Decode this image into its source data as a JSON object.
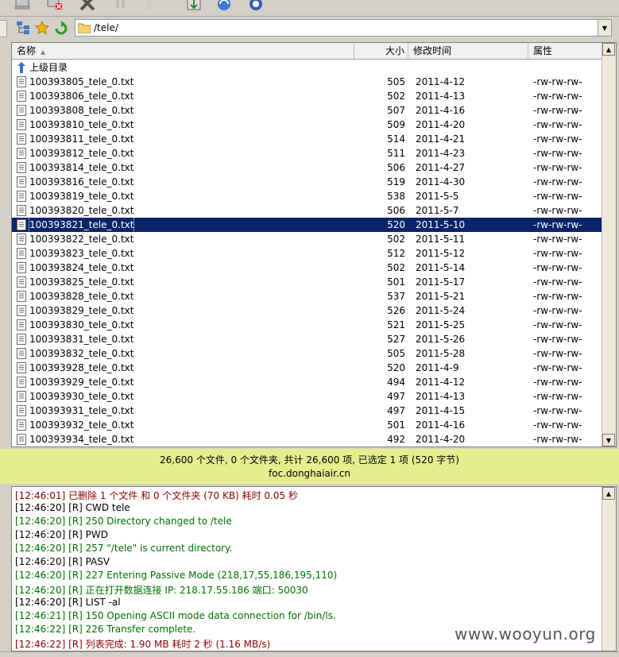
{
  "address": {
    "path": "/tele/"
  },
  "columns": {
    "name": "名称",
    "size": "大小",
    "modified": "修改时间",
    "attributes": "属性"
  },
  "parent_dir": "上级目录",
  "files": [
    {
      "name": "100393805_tele_0.txt",
      "size": "505",
      "date": "2011-4-12",
      "attr": "-rw-rw-rw-"
    },
    {
      "name": "100393806_tele_0.txt",
      "size": "502",
      "date": "2011-4-13",
      "attr": "-rw-rw-rw-"
    },
    {
      "name": "100393808_tele_0.txt",
      "size": "507",
      "date": "2011-4-16",
      "attr": "-rw-rw-rw-"
    },
    {
      "name": "100393810_tele_0.txt",
      "size": "509",
      "date": "2011-4-20",
      "attr": "-rw-rw-rw-"
    },
    {
      "name": "100393811_tele_0.txt",
      "size": "514",
      "date": "2011-4-21",
      "attr": "-rw-rw-rw-"
    },
    {
      "name": "100393812_tele_0.txt",
      "size": "511",
      "date": "2011-4-23",
      "attr": "-rw-rw-rw-"
    },
    {
      "name": "100393814_tele_0.txt",
      "size": "506",
      "date": "2011-4-27",
      "attr": "-rw-rw-rw-"
    },
    {
      "name": "100393816_tele_0.txt",
      "size": "519",
      "date": "2011-4-30",
      "attr": "-rw-rw-rw-"
    },
    {
      "name": "100393819_tele_0.txt",
      "size": "538",
      "date": "2011-5-5",
      "attr": "-rw-rw-rw-"
    },
    {
      "name": "100393820_tele_0.txt",
      "size": "506",
      "date": "2011-5-7",
      "attr": "-rw-rw-rw-"
    },
    {
      "name": "100393821_tele_0.txt",
      "size": "520",
      "date": "2011-5-10",
      "attr": "-rw-rw-rw-"
    },
    {
      "name": "100393822_tele_0.txt",
      "size": "502",
      "date": "2011-5-11",
      "attr": "-rw-rw-rw-"
    },
    {
      "name": "100393823_tele_0.txt",
      "size": "512",
      "date": "2011-5-12",
      "attr": "-rw-rw-rw-"
    },
    {
      "name": "100393824_tele_0.txt",
      "size": "502",
      "date": "2011-5-14",
      "attr": "-rw-rw-rw-"
    },
    {
      "name": "100393825_tele_0.txt",
      "size": "501",
      "date": "2011-5-17",
      "attr": "-rw-rw-rw-"
    },
    {
      "name": "100393828_tele_0.txt",
      "size": "537",
      "date": "2011-5-21",
      "attr": "-rw-rw-rw-"
    },
    {
      "name": "100393829_tele_0.txt",
      "size": "526",
      "date": "2011-5-24",
      "attr": "-rw-rw-rw-"
    },
    {
      "name": "100393830_tele_0.txt",
      "size": "521",
      "date": "2011-5-25",
      "attr": "-rw-rw-rw-"
    },
    {
      "name": "100393831_tele_0.txt",
      "size": "527",
      "date": "2011-5-26",
      "attr": "-rw-rw-rw-"
    },
    {
      "name": "100393832_tele_0.txt",
      "size": "505",
      "date": "2011-5-28",
      "attr": "-rw-rw-rw-"
    },
    {
      "name": "100393928_tele_0.txt",
      "size": "520",
      "date": "2011-4-9",
      "attr": "-rw-rw-rw-"
    },
    {
      "name": "100393929_tele_0.txt",
      "size": "494",
      "date": "2011-4-12",
      "attr": "-rw-rw-rw-"
    },
    {
      "name": "100393930_tele_0.txt",
      "size": "497",
      "date": "2011-4-13",
      "attr": "-rw-rw-rw-"
    },
    {
      "name": "100393931_tele_0.txt",
      "size": "497",
      "date": "2011-4-15",
      "attr": "-rw-rw-rw-"
    },
    {
      "name": "100393932_tele_0.txt",
      "size": "501",
      "date": "2011-4-16",
      "attr": "-rw-rw-rw-"
    },
    {
      "name": "100393934_tele_0.txt",
      "size": "492",
      "date": "2011-4-20",
      "attr": "-rw-rw-rw-"
    }
  ],
  "selected_file": "100393821_tele_0.txt",
  "status": {
    "summary": "26,600 个文件, 0 个文件夹, 共计 26,600 项, 已选定 1 项 (520 字节)",
    "host": "foc.donghaiair.cn"
  },
  "log": [
    {
      "text": "[12:46:01] 已删除 1 个文件 和 0 个文件夹 (70 KB) 耗时 0.05 秒",
      "color": "#8b0000"
    },
    {
      "text": "[12:46:20] [R] CWD tele",
      "color": "#000000"
    },
    {
      "text": "[12:46:20] [R] 250 Directory changed to /tele",
      "color": "#007000"
    },
    {
      "text": "[12:46:20] [R] PWD",
      "color": "#000000"
    },
    {
      "text": "[12:46:20] [R] 257 \"/tele\" is current directory.",
      "color": "#007000"
    },
    {
      "text": "[12:46:20] [R] PASV",
      "color": "#000000"
    },
    {
      "text": "[12:46:20] [R] 227 Entering Passive Mode (218,17,55,186,195,110)",
      "color": "#007000"
    },
    {
      "text": "[12:46:20] [R] 正在打开数据连接 IP: 218.17.55.186 端口: 50030",
      "color": "#007000"
    },
    {
      "text": "[12:46:20] [R] LIST -al",
      "color": "#000000"
    },
    {
      "text": "[12:46:21] [R] 150 Opening ASCII mode data connection for /bin/ls.",
      "color": "#007000"
    },
    {
      "text": "[12:46:22] [R] 226 Transfer complete.",
      "color": "#007000"
    },
    {
      "text": "[12:46:22] [R] 列表完成: 1.90 MB 耗时 2 秒 (1.16 MB/s)",
      "color": "#8b0000"
    }
  ],
  "watermark": "www.wooyun.org",
  "colors": {
    "status_bg": "#e3ef8f",
    "selection": "#0a246a"
  }
}
